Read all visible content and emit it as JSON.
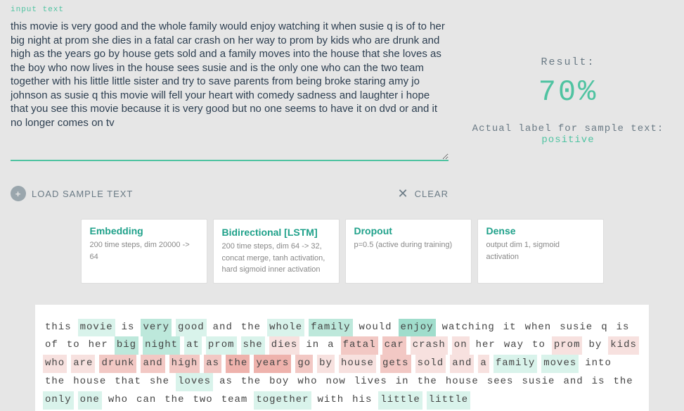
{
  "input": {
    "label": "input text",
    "value": "this movie is very good and the whole family would enjoy watching it when susie q is of to her big night at prom she dies in a fatal car crash on her way to prom by kids who are drunk and high as the years go by house gets sold and a family moves into the house that she loves as the boy who now lives in the house sees susie and is the only one who can the two team together with his little little sister and try to save parents from being broke staring amy jo johnson as susie q this movie will fell your heart with comedy sadness and laughter i hope that you see this movie because it is very good but no one seems to have it on dvd or and it no longer comes on tv"
  },
  "actions": {
    "load": "LOAD SAMPLE TEXT",
    "clear": "CLEAR"
  },
  "result": {
    "label": "Result:",
    "pct": "70%",
    "actual_prefix": "Actual label for sample text: ",
    "actual_value": "positive"
  },
  "layers": [
    {
      "title": "Embedding",
      "desc": "200 time steps, dim 20000 -> 64"
    },
    {
      "title": "Bidirectional [LSTM]",
      "desc": "200 time steps, dim 64 -> 32, concat merge, tanh activation, hard sigmoid inner activation"
    },
    {
      "title": "Dropout",
      "desc": "p=0.5 (active during training)"
    },
    {
      "title": "Dense",
      "desc": "output dim 1, sigmoid activation"
    }
  ],
  "tokens": [
    {
      "t": "this",
      "c": ""
    },
    {
      "t": "movie",
      "c": "p1"
    },
    {
      "t": "is",
      "c": ""
    },
    {
      "t": "very",
      "c": "p2"
    },
    {
      "t": "good",
      "c": "p1"
    },
    {
      "t": "and",
      "c": ""
    },
    {
      "t": "the",
      "c": ""
    },
    {
      "t": "whole",
      "c": "p1"
    },
    {
      "t": "family",
      "c": "p2"
    },
    {
      "t": "would",
      "c": ""
    },
    {
      "t": "enjoy",
      "c": "p3"
    },
    {
      "t": "watching",
      "c": ""
    },
    {
      "t": "it",
      "c": ""
    },
    {
      "t": "when",
      "c": ""
    },
    {
      "t": "susie",
      "c": ""
    },
    {
      "t": "q",
      "c": ""
    },
    {
      "t": "is",
      "c": ""
    },
    {
      "t": "of",
      "c": ""
    },
    {
      "t": "to",
      "c": ""
    },
    {
      "t": "her",
      "c": ""
    },
    {
      "t": "big",
      "c": "p2"
    },
    {
      "t": "night",
      "c": "p2"
    },
    {
      "t": "at",
      "c": "p1"
    },
    {
      "t": "prom",
      "c": "p1"
    },
    {
      "t": "she",
      "c": "p1"
    },
    {
      "t": "dies",
      "c": "n1"
    },
    {
      "t": "in",
      "c": ""
    },
    {
      "t": "a",
      "c": ""
    },
    {
      "t": "fatal",
      "c": "n2"
    },
    {
      "t": "car",
      "c": "n2"
    },
    {
      "t": "crash",
      "c": "n1"
    },
    {
      "t": "on",
      "c": "n1"
    },
    {
      "t": "her",
      "c": ""
    },
    {
      "t": "way",
      "c": ""
    },
    {
      "t": "to",
      "c": ""
    },
    {
      "t": "prom",
      "c": "n1"
    },
    {
      "t": "by",
      "c": ""
    },
    {
      "t": "kids",
      "c": "n1"
    },
    {
      "t": "who",
      "c": "n1"
    },
    {
      "t": "are",
      "c": "n1"
    },
    {
      "t": "drunk",
      "c": "n2"
    },
    {
      "t": "and",
      "c": "n2"
    },
    {
      "t": "high",
      "c": "n2"
    },
    {
      "t": "as",
      "c": "n2"
    },
    {
      "t": "the",
      "c": "n3"
    },
    {
      "t": "years",
      "c": "n3"
    },
    {
      "t": "go",
      "c": "n2"
    },
    {
      "t": "by",
      "c": "n1"
    },
    {
      "t": "house",
      "c": "n1"
    },
    {
      "t": "gets",
      "c": "n2"
    },
    {
      "t": "sold",
      "c": "n1"
    },
    {
      "t": "and",
      "c": "n1"
    },
    {
      "t": "a",
      "c": "n1"
    },
    {
      "t": "family",
      "c": "p1"
    },
    {
      "t": "moves",
      "c": "p1"
    },
    {
      "t": "into",
      "c": ""
    },
    {
      "t": "the",
      "c": ""
    },
    {
      "t": "house",
      "c": ""
    },
    {
      "t": "that",
      "c": ""
    },
    {
      "t": "she",
      "c": ""
    },
    {
      "t": "loves",
      "c": "p1"
    },
    {
      "t": "as",
      "c": ""
    },
    {
      "t": "the",
      "c": ""
    },
    {
      "t": "boy",
      "c": ""
    },
    {
      "t": "who",
      "c": ""
    },
    {
      "t": "now",
      "c": ""
    },
    {
      "t": "lives",
      "c": ""
    },
    {
      "t": "in",
      "c": ""
    },
    {
      "t": "the",
      "c": ""
    },
    {
      "t": "house",
      "c": ""
    },
    {
      "t": "sees",
      "c": ""
    },
    {
      "t": "susie",
      "c": ""
    },
    {
      "t": "and",
      "c": ""
    },
    {
      "t": "is",
      "c": ""
    },
    {
      "t": "the",
      "c": ""
    },
    {
      "t": "only",
      "c": "p1"
    },
    {
      "t": "one",
      "c": "p1"
    },
    {
      "t": "who",
      "c": ""
    },
    {
      "t": "can",
      "c": ""
    },
    {
      "t": "the",
      "c": ""
    },
    {
      "t": "two",
      "c": ""
    },
    {
      "t": "team",
      "c": ""
    },
    {
      "t": "together",
      "c": "p1"
    },
    {
      "t": "with",
      "c": ""
    },
    {
      "t": "his",
      "c": ""
    },
    {
      "t": "little",
      "c": "p1"
    },
    {
      "t": "little",
      "c": "p1"
    }
  ]
}
